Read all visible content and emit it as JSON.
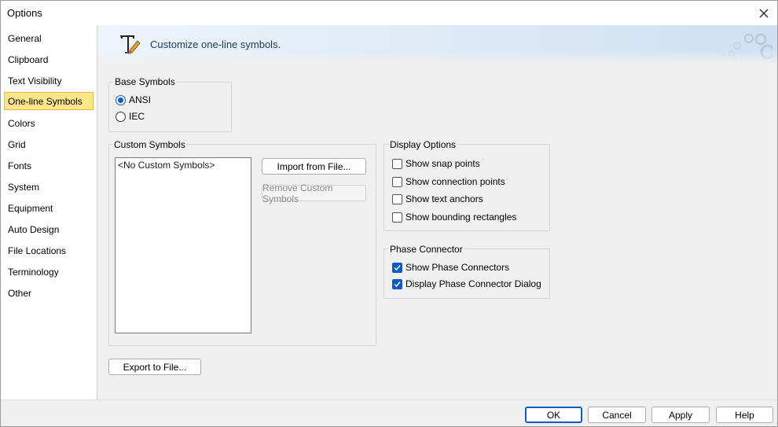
{
  "window": {
    "title": "Options"
  },
  "sidebar": {
    "items": [
      {
        "label": "General"
      },
      {
        "label": "Clipboard"
      },
      {
        "label": "Text Visibility"
      },
      {
        "label": "One-line Symbols"
      },
      {
        "label": "Colors"
      },
      {
        "label": "Grid"
      },
      {
        "label": "Fonts"
      },
      {
        "label": "System"
      },
      {
        "label": "Equipment"
      },
      {
        "label": "Auto Design"
      },
      {
        "label": "File Locations"
      },
      {
        "label": "Terminology"
      },
      {
        "label": "Other"
      }
    ],
    "selected": "One-line Symbols"
  },
  "banner": {
    "title": "Customize one-line symbols.",
    "icon": "text-tool-icon"
  },
  "base_symbols": {
    "label": "Base Symbols",
    "options": [
      {
        "label": "ANSI",
        "selected": true
      },
      {
        "label": "IEC",
        "selected": false
      }
    ]
  },
  "custom_symbols": {
    "label": "Custom Symbols",
    "list_items": [
      "<No Custom Symbols>"
    ],
    "import_button": "Import from File...",
    "remove_button": "Remove Custom Symbols"
  },
  "display_options": {
    "label": "Display Options",
    "checkboxes": [
      {
        "label": "Show snap points",
        "checked": false
      },
      {
        "label": "Show connection points",
        "checked": false
      },
      {
        "label": "Show text anchors",
        "checked": false
      },
      {
        "label": "Show bounding rectangles",
        "checked": false
      }
    ]
  },
  "phase_connector": {
    "label": "Phase Connector",
    "checkboxes": [
      {
        "label": "Show Phase Connectors",
        "checked": true
      },
      {
        "label": "Display Phase Connector Dialog",
        "checked": true
      }
    ]
  },
  "export_button": "Export to File...",
  "footer": {
    "ok": "OK",
    "cancel": "Cancel",
    "apply": "Apply",
    "help": "Help"
  },
  "colors": {
    "accent": "#0a5bc4",
    "sidebar_selected_bg": "#fde58a",
    "sidebar_selected_border": "#e9b63e"
  }
}
